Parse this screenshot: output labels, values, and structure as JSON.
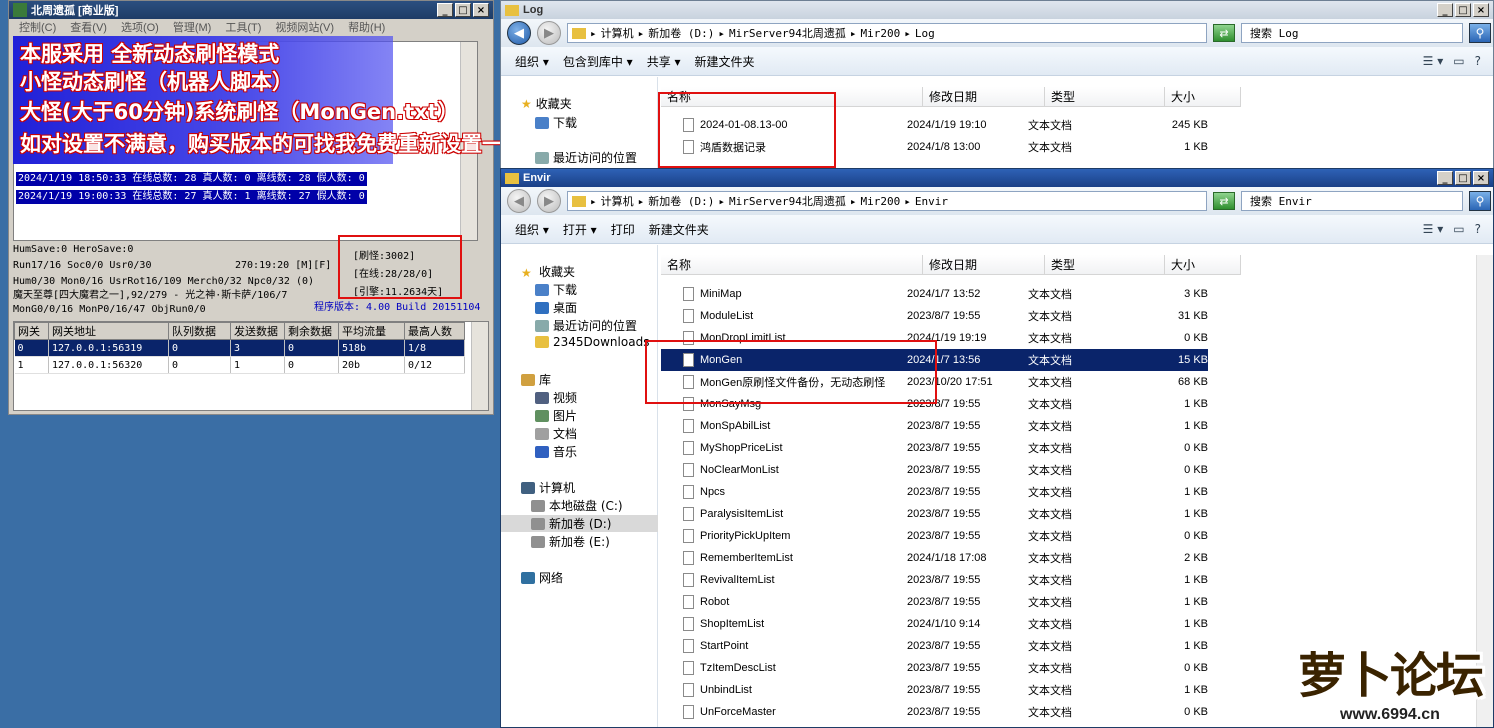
{
  "server": {
    "title": "北周遗孤 [商业版]",
    "menu": [
      "控制(C)",
      "查看(V)",
      "选项(O)",
      "管理(M)",
      "工具(T)",
      "视频网站(V)",
      "帮助(H)"
    ],
    "log_lines": [
      "2024/1/19 18:50:33 在线总数: 28 真人数: 0 离线数: 28 假人数: 0",
      "2024/1/19 19:00:33 在线总数: 27 真人数: 1 离线数: 27 假人数: 0"
    ],
    "stats": [
      "HumSave:0 HeroSave:0",
      "Run17/16 Soc0/0 Usr0/30",
      "Hum0/30 Mon0/16 UsrRot16/109 Merch0/32 Npc0/32 (0)",
      "魔天至尊[四大魔君之一],92/279 - 光之神·斯卡萨/106/7",
      "MonG0/0/16 MonP0/16/47 ObjRun0/0"
    ],
    "time": "270:19:20 [M][F]",
    "counters": [
      "[刷怪:3002]",
      "[在线:28/28/0]",
      "[引擎:11.2634天]"
    ],
    "version": "程序版本: 4.00 Build 20151104",
    "grid": {
      "headers": [
        "网关",
        "网关地址",
        "队列数据",
        "发送数据",
        "剩余数据",
        "平均流量",
        "最高人数"
      ],
      "rows": [
        [
          "0",
          "127.0.0.1:56319",
          "0",
          "3",
          "0",
          "518b",
          "1/8"
        ],
        [
          "1",
          "127.0.0.1:56320",
          "0",
          "1",
          "0",
          "20b",
          "0/12"
        ]
      ]
    }
  },
  "annotation": [
    "本服采用 全新动态刷怪模式",
    "小怪动态刷怪（机器人脚本）",
    "大怪(大于60分钟)系统刷怪（MonGen.txt）",
    "如对设置不满意，购买版本的可找我免费重新设置一次"
  ],
  "log_win": {
    "title": "Log",
    "path": [
      "计算机",
      "新加卷 (D:)",
      "MirServer94北周遗孤",
      "Mir200",
      "Log"
    ],
    "search": "搜索 Log",
    "cmds": [
      "组织 ▾",
      "包含到库中 ▾",
      "共享 ▾",
      "新建文件夹"
    ],
    "tree": [
      "收藏夹",
      "下载",
      "最近访问的位置"
    ],
    "headers": [
      "名称",
      "修改日期",
      "类型",
      "大小"
    ],
    "files": [
      [
        "2024-01-08.13-00",
        "2024/1/19 19:10",
        "文本文档",
        "245 KB"
      ],
      [
        "鸿盾数据记录",
        "2024/1/8 13:00",
        "文本文档",
        "1 KB"
      ]
    ]
  },
  "envir_win": {
    "title": "Envir",
    "path": [
      "计算机",
      "新加卷 (D:)",
      "MirServer94北周遗孤",
      "Mir200",
      "Envir"
    ],
    "search": "搜索 Envir",
    "cmds": [
      "组织 ▾",
      "打开 ▾",
      "打印",
      "新建文件夹"
    ],
    "tree": [
      "收藏夹",
      "下载",
      "桌面",
      "最近访问的位置",
      "2345Downloads",
      "库",
      "视频",
      "图片",
      "文档",
      "音乐",
      "计算机",
      "本地磁盘 (C:)",
      "新加卷 (D:)",
      "新加卷 (E:)",
      "网络"
    ],
    "headers": [
      "名称",
      "修改日期",
      "类型",
      "大小"
    ],
    "files": [
      [
        "MiniMap",
        "2024/1/7 13:52",
        "文本文档",
        "3 KB"
      ],
      [
        "ModuleList",
        "2023/8/7 19:55",
        "文本文档",
        "31 KB"
      ],
      [
        "MonDropLimitList",
        "2024/1/19 19:19",
        "文本文档",
        "0 KB"
      ],
      [
        "MonGen",
        "2024/1/7 13:56",
        "文本文档",
        "15 KB"
      ],
      [
        "MonGen原刷怪文件备份，无动态刷怪",
        "2023/10/20 17:51",
        "文本文档",
        "68 KB"
      ],
      [
        "MonSayMsg",
        "2023/8/7 19:55",
        "文本文档",
        "1 KB"
      ],
      [
        "MonSpAbilList",
        "2023/8/7 19:55",
        "文本文档",
        "1 KB"
      ],
      [
        "MyShopPriceList",
        "2023/8/7 19:55",
        "文本文档",
        "0 KB"
      ],
      [
        "NoClearMonList",
        "2023/8/7 19:55",
        "文本文档",
        "0 KB"
      ],
      [
        "Npcs",
        "2023/8/7 19:55",
        "文本文档",
        "1 KB"
      ],
      [
        "ParalysisItemList",
        "2023/8/7 19:55",
        "文本文档",
        "1 KB"
      ],
      [
        "PriorityPickUpItem",
        "2023/8/7 19:55",
        "文本文档",
        "0 KB"
      ],
      [
        "RememberItemList",
        "2024/1/18 17:08",
        "文本文档",
        "2 KB"
      ],
      [
        "RevivalItemList",
        "2023/8/7 19:55",
        "文本文档",
        "1 KB"
      ],
      [
        "Robot",
        "2023/8/7 19:55",
        "文本文档",
        "1 KB"
      ],
      [
        "ShopItemList",
        "2024/1/10 9:14",
        "文本文档",
        "1 KB"
      ],
      [
        "StartPoint",
        "2023/8/7 19:55",
        "文本文档",
        "1 KB"
      ],
      [
        "TzItemDescList",
        "2023/8/7 19:55",
        "文本文档",
        "0 KB"
      ],
      [
        "UnbindList",
        "2023/8/7 19:55",
        "文本文档",
        "1 KB"
      ],
      [
        "UnForceMaster",
        "2023/8/7 19:55",
        "文本文档",
        "0 KB"
      ]
    ],
    "selected_index": 3
  },
  "watermark": {
    "text": "萝卜论坛",
    "url": "www.6994.cn"
  }
}
